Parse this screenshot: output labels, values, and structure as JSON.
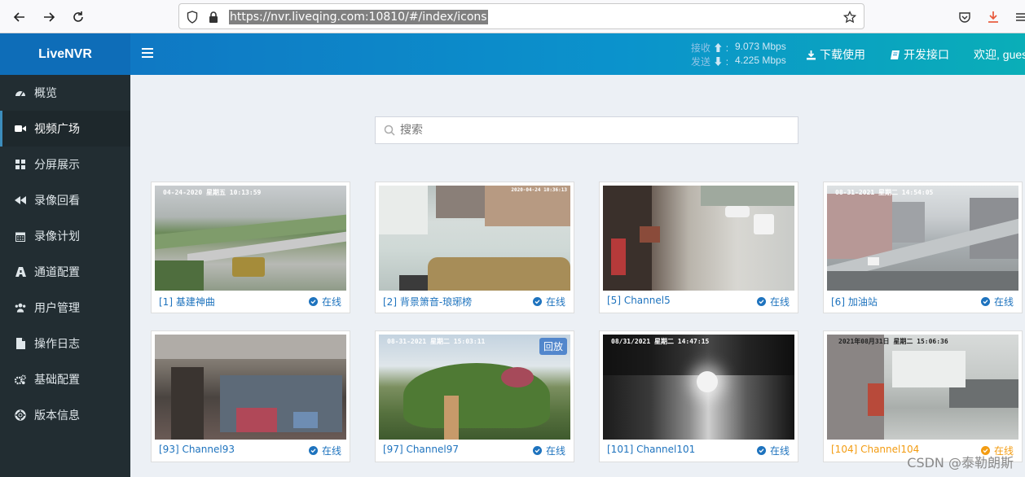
{
  "browser": {
    "url": "https://nvr.liveqing.com:10810/#/index/icons"
  },
  "header": {
    "brand": "LiveNVR",
    "rx_label": "接收",
    "rx_value": "9.073 Mbps",
    "tx_label": "发送",
    "tx_value": "4.225 Mbps",
    "download_label": "下载使用",
    "api_label": "开发接口",
    "welcome": "欢迎, gues"
  },
  "sidebar": {
    "items": [
      {
        "label": "概览",
        "icon": "dashboard-icon"
      },
      {
        "label": "视频广场",
        "icon": "video-camera-icon",
        "active": true
      },
      {
        "label": "分屏展示",
        "icon": "grid-icon"
      },
      {
        "label": "录像回看",
        "icon": "rewind-icon"
      },
      {
        "label": "录像计划",
        "icon": "calendar-icon"
      },
      {
        "label": "通道配置",
        "icon": "sitemap-icon"
      },
      {
        "label": "用户管理",
        "icon": "users-icon"
      },
      {
        "label": "操作日志",
        "icon": "file-icon"
      },
      {
        "label": "基础配置",
        "icon": "cogs-icon"
      },
      {
        "label": "版本信息",
        "icon": "lifebuoy-icon"
      }
    ]
  },
  "search": {
    "placeholder": "搜索"
  },
  "channels": [
    {
      "name": "[1] 基建神曲",
      "status": "在线",
      "osd": "04-24-2020 星期五 10:13:59"
    },
    {
      "name": "[2] 背景箫音-琅琊榜",
      "status": "在线",
      "osd": "2020-04-24 10:36:13"
    },
    {
      "name": "[5] Channel5",
      "status": "在线",
      "osd": ""
    },
    {
      "name": "[6] 加油站",
      "status": "在线",
      "osd": "08-31-2021 星期二 14:54:05"
    },
    {
      "name": "[93] Channel93",
      "status": "在线",
      "osd": ""
    },
    {
      "name": "[97] Channel97",
      "status": "在线",
      "osd": "08-31-2021 星期二 15:03:11",
      "badge": "回放"
    },
    {
      "name": "[101] Channel101",
      "status": "在线",
      "osd": "08/31/2021 星期二 14:47:15"
    },
    {
      "name": "[104] Channel104",
      "status": "在线",
      "osd": "2021年08月31日 星期二 15:06:36",
      "warn": true
    }
  ],
  "watermark": "CSDN @泰勒朗斯"
}
